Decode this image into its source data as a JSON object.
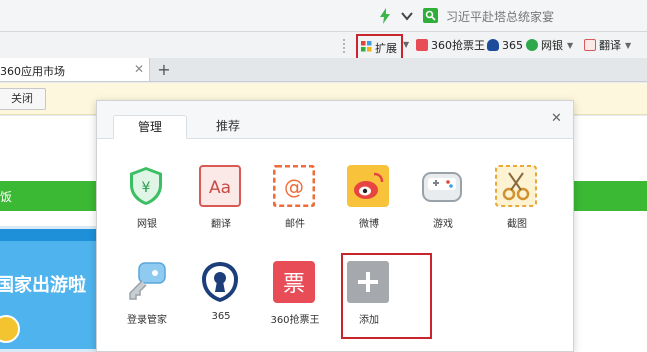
{
  "toolbar": {
    "search_text": "习近平赴塔总统家宴"
  },
  "extensions_bar": {
    "expand_label": "扩展",
    "items": [
      {
        "label": "360抢票王",
        "color": "#e84c56"
      },
      {
        "label": "365",
        "color": "#1d4c9b"
      },
      {
        "label": "网银",
        "color": "#2ea84a"
      },
      {
        "label": "翻译",
        "color": "#d65a5a"
      }
    ]
  },
  "tabs": [
    {
      "title": "360应用市场"
    }
  ],
  "notification": {
    "close_label": "关闭"
  },
  "page": {
    "greenbar_text": "饭",
    "banner_text": "国家出游啦"
  },
  "panel": {
    "tabs": [
      {
        "label": "管理",
        "active": true
      },
      {
        "label": "推荐",
        "active": false
      }
    ],
    "apps_row1": [
      {
        "label": "网银",
        "icon": "shield-yen-icon",
        "color": "#3cbf64"
      },
      {
        "label": "翻译",
        "icon": "translate-icon",
        "color": "#d95a55"
      },
      {
        "label": "邮件",
        "icon": "mail-icon",
        "color": "#ef6b3a"
      },
      {
        "label": "微博",
        "icon": "weibo-icon",
        "color": "#e64541"
      },
      {
        "label": "游戏",
        "icon": "gamepad-icon",
        "color": "#9aa2a9"
      },
      {
        "label": "截图",
        "icon": "scissors-icon",
        "color": "#e8a93a"
      }
    ],
    "apps_row2": [
      {
        "label": "登录管家",
        "icon": "key-icon",
        "color": "#6fb7e8"
      },
      {
        "label": "365",
        "icon": "keyhole-icon",
        "color": "#1c3e7a"
      },
      {
        "label": "360抢票王",
        "icon": "ticket-icon",
        "color": "#e84c56"
      },
      {
        "label": "添加",
        "icon": "plus-icon",
        "color": "#a5a9ad"
      }
    ]
  },
  "colors": {
    "accent_green": "#3bb834",
    "highlight_red": "#c8262c"
  }
}
